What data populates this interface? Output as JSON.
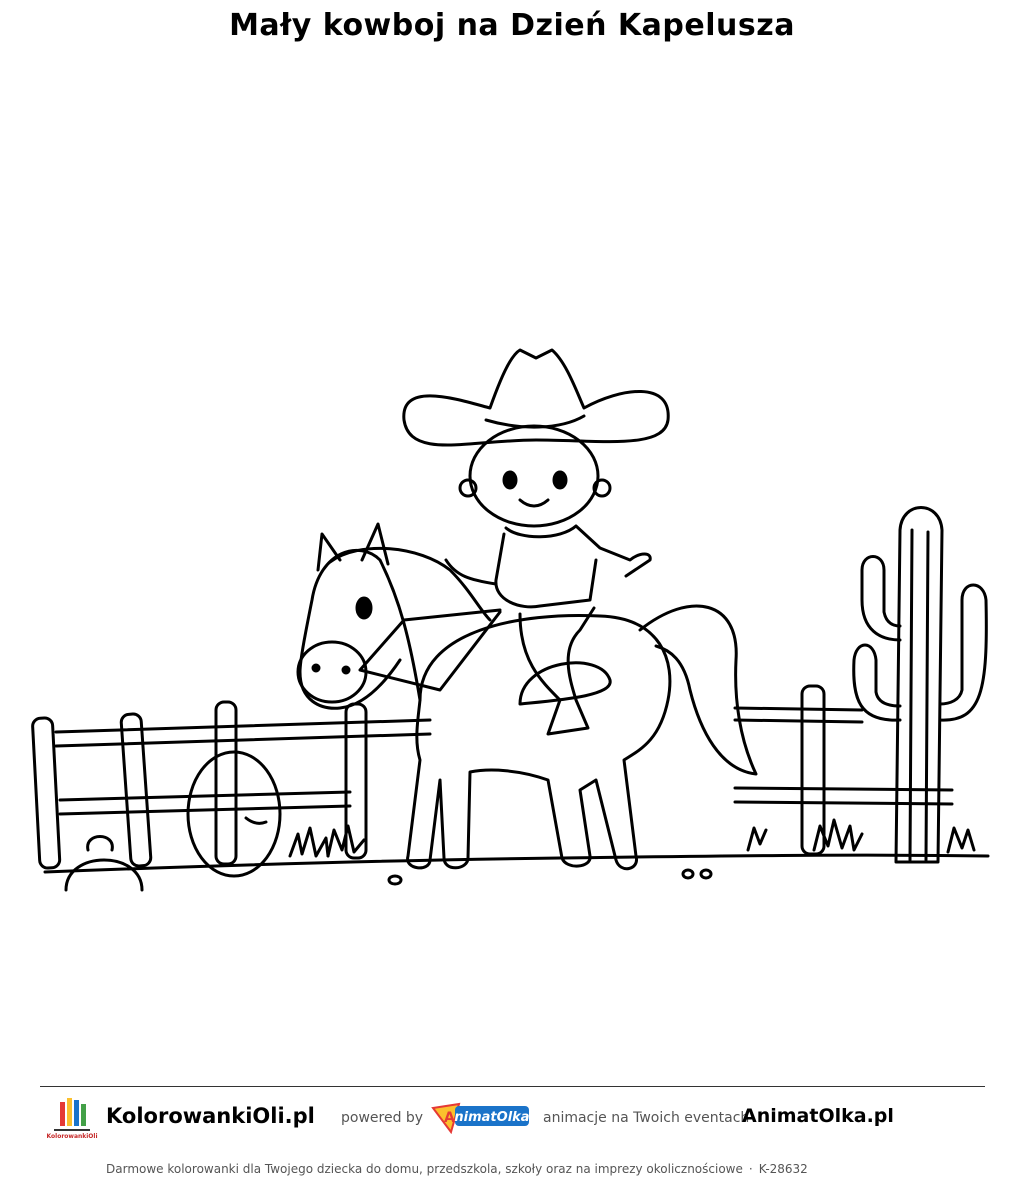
{
  "title": "Mały kowboj na Dzień Kapelusza",
  "footer": {
    "site_name": "KolorowankiOli.pl",
    "powered_by": "powered by",
    "partner_tagline": "animacje na Twoich eventach",
    "partner_site": "AnimatOlka.pl",
    "logo_left_text": "KolorowankiOli",
    "logo_partner_text": "AnimatOlka",
    "description": "Darmowe kolorowanki dla Twojego dziecka do domu, przedszkola, szkoły oraz na imprezy okolicznościowe",
    "separator": "·",
    "code": "K-28632"
  },
  "colors": {
    "line": "#000000",
    "partner_blue": "#1a73c9",
    "partner_red": "#e53935",
    "partner_yellow": "#fbc02d"
  },
  "icons": [
    "kolorowanki-logo-icon",
    "animatolka-logo-icon"
  ]
}
